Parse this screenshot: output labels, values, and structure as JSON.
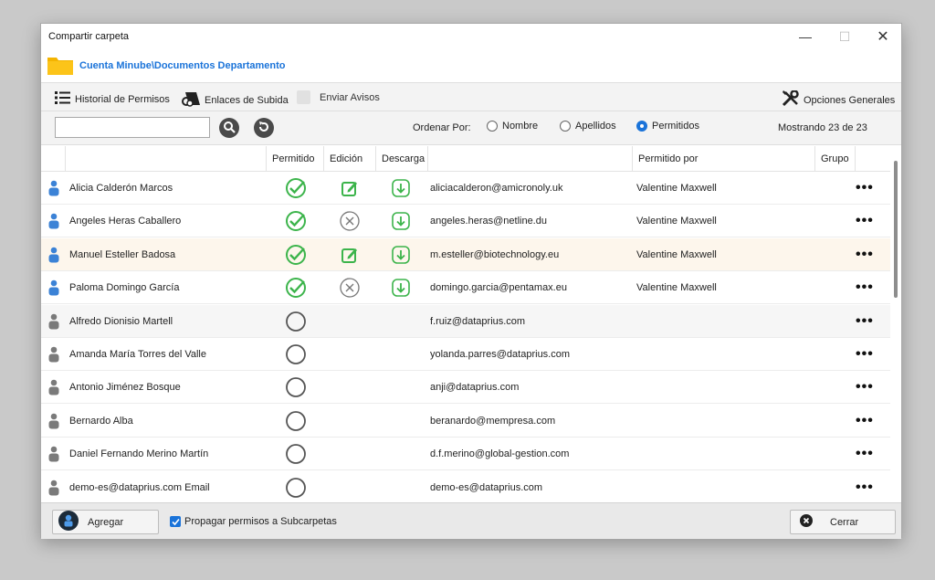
{
  "window": {
    "title": "Compartir carpeta",
    "minimize": "—",
    "maximize": "☐",
    "close": "✕"
  },
  "path": {
    "text": "Cuenta Minube\\Documentos Departamento"
  },
  "toolbar": {
    "history_label": "Historial de Permisos",
    "upload_links_label": "Enlaces de Subida",
    "send_notices_label": "Enviar Avisos",
    "general_options_label": "Opciones Generales"
  },
  "filter": {
    "search_value": "",
    "sort_label": "Ordenar Por:",
    "sort_options": [
      "Nombre",
      "Apellidos",
      "Permitidos"
    ],
    "sort_selected": "Permitidos",
    "showing": "Mostrando 23 de 23"
  },
  "columns": {
    "allowed": "Permitido",
    "edit": "Edición",
    "download": "Descarga",
    "allowed_by": "Permitido por",
    "group": "Grupo"
  },
  "rows": [
    {
      "name": "Alicia Calderón Marcos",
      "allowed": true,
      "edit": "allowed",
      "download": true,
      "email": "aliciacalderon@amicronoly.uk",
      "allowed_by": "Valentine Maxwell",
      "more": "•••"
    },
    {
      "name": "Angeles Heras Caballero",
      "allowed": true,
      "edit": "denied",
      "download": true,
      "email": "angeles.heras@netline.du",
      "allowed_by": "Valentine Maxwell",
      "more": "•••"
    },
    {
      "name": "Manuel Esteller Badosa",
      "allowed": true,
      "edit": "allowed",
      "download": true,
      "email": "m.esteller@biotechnology.eu",
      "allowed_by": "Valentine Maxwell",
      "more": "•••"
    },
    {
      "name": "Paloma Domingo García",
      "allowed": true,
      "edit": "denied",
      "download": true,
      "email": "domingo.garcia@pentamax.eu",
      "allowed_by": "Valentine Maxwell",
      "more": "•••"
    },
    {
      "name": "Alfredo Dionisio Martell",
      "allowed": false,
      "email": "f.ruiz@dataprius.com",
      "allowed_by": "",
      "more": "•••"
    },
    {
      "name": "Amanda María Torres del Valle",
      "allowed": false,
      "email": "yolanda.parres@dataprius.com",
      "allowed_by": "",
      "more": "•••"
    },
    {
      "name": "Antonio Jiménez Bosque",
      "allowed": false,
      "email": "anji@dataprius.com",
      "allowed_by": "",
      "more": "•••"
    },
    {
      "name": "Bernardo Alba",
      "allowed": false,
      "email": "beranardo@mempresa.com",
      "allowed_by": "",
      "more": "•••"
    },
    {
      "name": "Daniel Fernando Merino Martín",
      "allowed": false,
      "email": "d.f.merino@global-gestion.com",
      "allowed_by": "",
      "more": "•••"
    },
    {
      "name": "demo-es@dataprius.com Email",
      "allowed": false,
      "email": "demo-es@dataprius.com",
      "allowed_by": "",
      "more": "•••"
    }
  ],
  "footer": {
    "add_label": "Agregar",
    "propagate_label": "Propagar permisos a Subcarpetas",
    "propagate_checked": true,
    "close_label": "Cerrar"
  },
  "colors": {
    "accent": "#1a73d9",
    "check_green": "#3cb44b",
    "allowed_user": "#3b82d6",
    "other_user": "#7a7a7a"
  }
}
